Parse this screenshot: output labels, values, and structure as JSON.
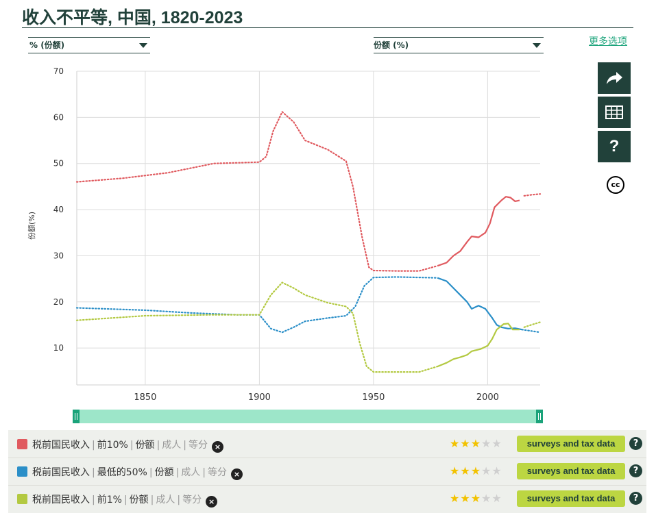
{
  "title": "收入不平等, 中国, 1820-2023",
  "controls": {
    "left_select": "% (份额)",
    "right_select": "份额 (%)",
    "more_options": "更多选项"
  },
  "icons": {
    "share": "share-icon",
    "table": "table-icon",
    "help": "help-icon",
    "license": "cc-icon",
    "cc_text": "cc"
  },
  "chart_data": {
    "type": "line",
    "ylabel": "份额(%)",
    "xlim": [
      1820,
      2023
    ],
    "ylim": [
      2,
      70
    ],
    "yticks": [
      10,
      20,
      30,
      40,
      50,
      60,
      70
    ],
    "xticks": [
      1850,
      1900,
      1950,
      2000
    ],
    "grid": true,
    "series": [
      {
        "name": "税前国民收入 | 前10% | 份额 | 成人 | 等分",
        "color": "#e05a5f",
        "dotted_until": 1978,
        "dotted_after": 2015,
        "points": [
          [
            1820,
            46
          ],
          [
            1840,
            46.8
          ],
          [
            1860,
            48
          ],
          [
            1880,
            50
          ],
          [
            1900,
            50.3
          ],
          [
            1903,
            51.5
          ],
          [
            1906,
            57
          ],
          [
            1910,
            61.2
          ],
          [
            1915,
            59
          ],
          [
            1920,
            55
          ],
          [
            1930,
            53
          ],
          [
            1938,
            50.5
          ],
          [
            1941,
            45
          ],
          [
            1945,
            34
          ],
          [
            1948,
            27.5
          ],
          [
            1950,
            26.8
          ],
          [
            1960,
            26.7
          ],
          [
            1970,
            26.7
          ],
          [
            1978,
            27.8
          ],
          [
            1982,
            28.5
          ],
          [
            1985,
            30
          ],
          [
            1988,
            31
          ],
          [
            1991,
            33
          ],
          [
            1993,
            34.2
          ],
          [
            1996,
            34
          ],
          [
            1999,
            35
          ],
          [
            2001,
            37
          ],
          [
            2003,
            40.5
          ],
          [
            2006,
            42
          ],
          [
            2008,
            42.8
          ],
          [
            2010,
            42.6
          ],
          [
            2012,
            41.8
          ],
          [
            2014,
            42
          ],
          [
            2016,
            43
          ],
          [
            2019,
            43.2
          ],
          [
            2023,
            43.4
          ]
        ]
      },
      {
        "name": "税前国民收入 | 最低的50% | 份额 | 成人 | 等分",
        "color": "#2b8fc8",
        "dotted_until": 1978,
        "dotted_after": 2015,
        "points": [
          [
            1820,
            18.7
          ],
          [
            1850,
            18.2
          ],
          [
            1870,
            17.6
          ],
          [
            1890,
            17.2
          ],
          [
            1900,
            17.2
          ],
          [
            1905,
            14.2
          ],
          [
            1910,
            13.4
          ],
          [
            1915,
            14.5
          ],
          [
            1920,
            15.8
          ],
          [
            1930,
            16.5
          ],
          [
            1938,
            17
          ],
          [
            1942,
            19
          ],
          [
            1946,
            23.5
          ],
          [
            1950,
            25.3
          ],
          [
            1960,
            25.4
          ],
          [
            1970,
            25.3
          ],
          [
            1978,
            25.2
          ],
          [
            1982,
            24.5
          ],
          [
            1985,
            23
          ],
          [
            1988,
            21.5
          ],
          [
            1991,
            20
          ],
          [
            1993,
            18.5
          ],
          [
            1996,
            19.2
          ],
          [
            1999,
            18.5
          ],
          [
            2002,
            16.5
          ],
          [
            2004,
            15
          ],
          [
            2006,
            14.5
          ],
          [
            2009,
            14.2
          ],
          [
            2012,
            14.3
          ],
          [
            2015,
            14
          ],
          [
            2019,
            13.7
          ],
          [
            2023,
            13.4
          ]
        ]
      },
      {
        "name": "税前国民收入 | 前1% | 份额 | 成人 | 等分",
        "color": "#b3c941",
        "dotted_until": 1978,
        "dotted_after": 2015,
        "points": [
          [
            1820,
            16
          ],
          [
            1850,
            17
          ],
          [
            1880,
            17.2
          ],
          [
            1900,
            17.2
          ],
          [
            1905,
            21.5
          ],
          [
            1910,
            24.2
          ],
          [
            1915,
            23
          ],
          [
            1920,
            21.5
          ],
          [
            1930,
            19.8
          ],
          [
            1938,
            19
          ],
          [
            1941,
            17.5
          ],
          [
            1944,
            11
          ],
          [
            1947,
            6
          ],
          [
            1950,
            4.8
          ],
          [
            1960,
            4.8
          ],
          [
            1970,
            4.8
          ],
          [
            1978,
            6
          ],
          [
            1982,
            6.8
          ],
          [
            1985,
            7.6
          ],
          [
            1988,
            8
          ],
          [
            1991,
            8.5
          ],
          [
            1993,
            9.3
          ],
          [
            1997,
            9.8
          ],
          [
            2000,
            10.5
          ],
          [
            2002,
            12
          ],
          [
            2004,
            14
          ],
          [
            2007,
            15.2
          ],
          [
            2009,
            15.3
          ],
          [
            2011,
            14
          ],
          [
            2014,
            14
          ],
          [
            2016,
            14.5
          ],
          [
            2019,
            15
          ],
          [
            2023,
            15.6
          ]
        ]
      }
    ]
  },
  "legend": [
    {
      "color": "#e05a5f",
      "main": "税前国民收入",
      "group": "前10%",
      "measure": "份额",
      "pop": "成人",
      "eq": "等分",
      "rating": 3,
      "max_rating": 5,
      "source": "surveys and tax data",
      "remove": "×",
      "help": "?"
    },
    {
      "color": "#2b8fc8",
      "main": "税前国民收入",
      "group": "最低的50%",
      "measure": "份额",
      "pop": "成人",
      "eq": "等分",
      "rating": 3,
      "max_rating": 5,
      "source": "surveys and tax data",
      "remove": "×",
      "help": "?"
    },
    {
      "color": "#b3c941",
      "main": "税前国民收入",
      "group": "前1%",
      "measure": "份额",
      "pop": "成人",
      "eq": "等分",
      "rating": 3,
      "max_rating": 5,
      "source": "surveys and tax data",
      "remove": "×",
      "help": "?"
    }
  ]
}
